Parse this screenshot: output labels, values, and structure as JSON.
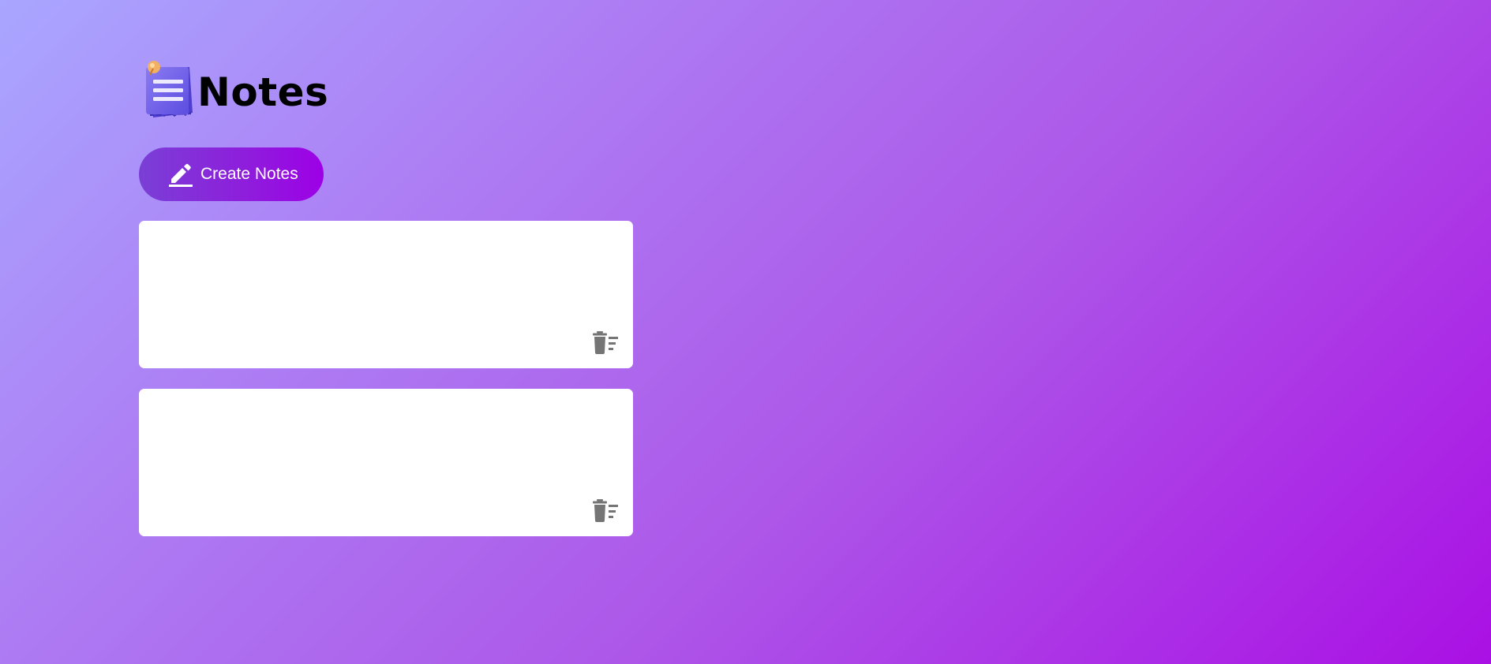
{
  "app": {
    "title": "Notes",
    "logo_icon": "notepad-icon"
  },
  "toolbar": {
    "create_label": "Create Notes",
    "create_icon": "pencil-icon"
  },
  "notes": [
    {
      "text": "",
      "delete_icon": "delete-sweep-icon"
    },
    {
      "text": "",
      "delete_icon": "delete-sweep-icon"
    }
  ],
  "colors": {
    "bg_start": "#a9a6ff",
    "bg_end": "#aa10e4",
    "button_start": "#7a3fd6",
    "button_end": "#9d00e6",
    "icon_gray": "#757575",
    "logo_purple": "#6d5ce8"
  }
}
